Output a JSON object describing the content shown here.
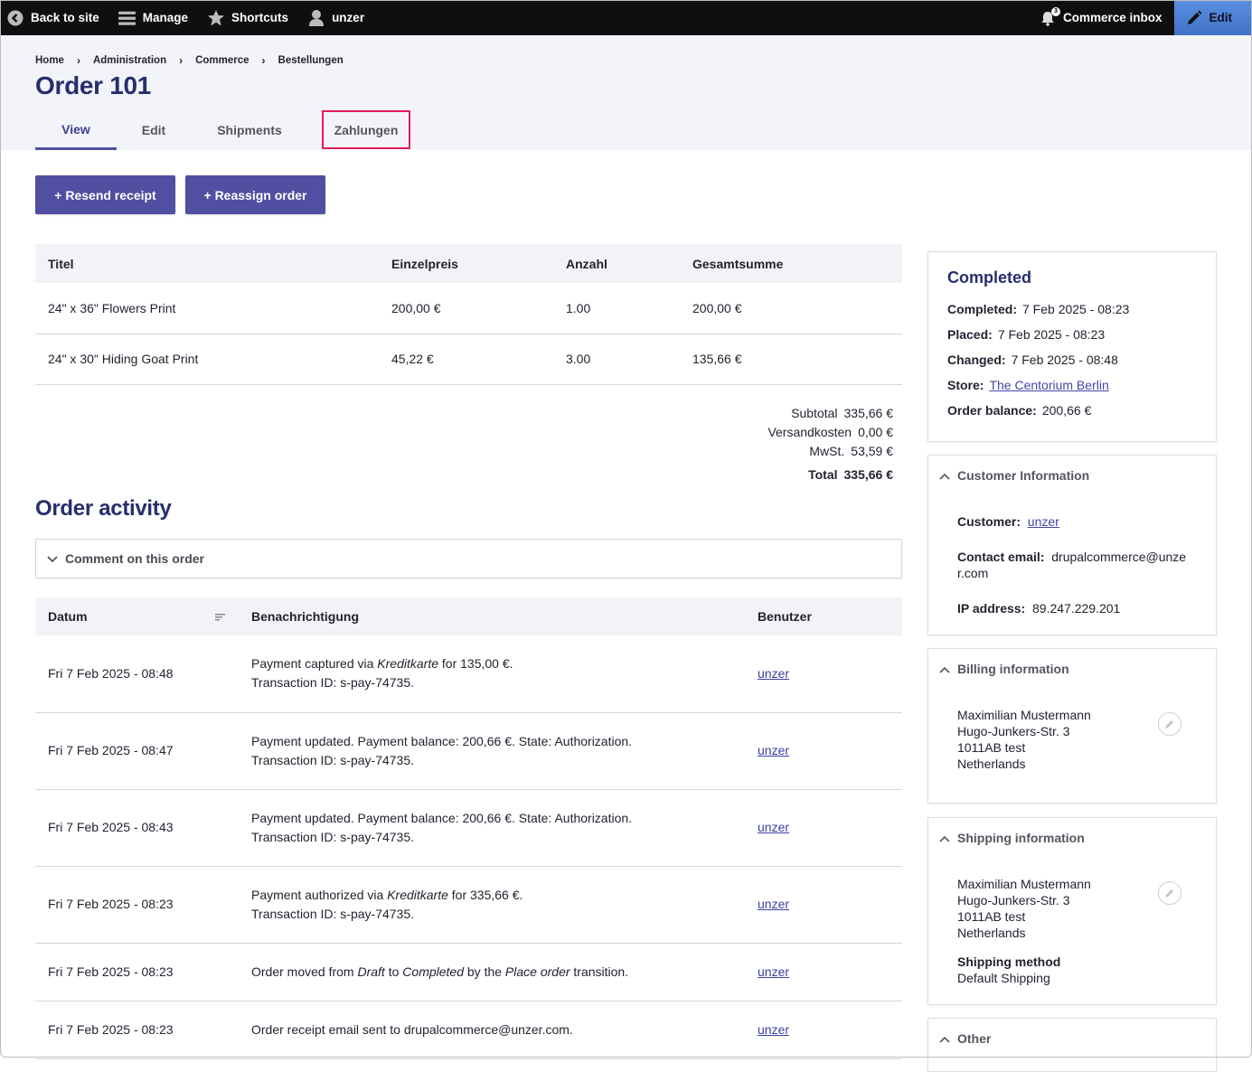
{
  "toolbar": {
    "back_to_site": "Back to site",
    "manage": "Manage",
    "shortcuts": "Shortcuts",
    "user": "unzer",
    "commerce_inbox": "Commerce inbox",
    "inbox_count": "3",
    "edit": "Edit"
  },
  "breadcrumb": [
    "Home",
    "Administration",
    "Commerce",
    "Bestellungen"
  ],
  "page_title": "Order 101",
  "tabs": [
    {
      "label": "View",
      "active": true
    },
    {
      "label": "Edit",
      "active": false
    },
    {
      "label": "Shipments",
      "active": false
    },
    {
      "label": "Zahlungen",
      "active": false,
      "highlighted": true
    }
  ],
  "actions": {
    "resend_receipt": "+ Resend receipt",
    "reassign_order": "+ Reassign order"
  },
  "order_items": {
    "headers": [
      "Titel",
      "Einzelpreis",
      "Anzahl",
      "Gesamtsumme"
    ],
    "rows": [
      [
        "24\" x 36\" Flowers Print",
        "200,00 €",
        "1.00",
        "200,00 €"
      ],
      [
        "24\" x 30\" Hiding Goat Print",
        "45,22 €",
        "3.00",
        "135,66 €"
      ]
    ]
  },
  "totals": {
    "subtotal_label": "Subtotal",
    "subtotal": "335,66 €",
    "shipping_label": "Versandkosten",
    "shipping": "0,00 €",
    "tax_label": "MwSt.",
    "tax": "53,59 €",
    "total_label": "Total",
    "total": "335,66 €"
  },
  "activity": {
    "title": "Order activity",
    "comment_label": "Comment on this order",
    "headers": [
      "Datum",
      "Benachrichtigung",
      "Benutzer"
    ],
    "rows": [
      {
        "date": "Fri 7 Feb 2025 - 08:48",
        "line1_html": "Payment captured via <em>Kreditkarte</em> for 135,00 €.",
        "line2": "Transaction ID: s-pay-74735.",
        "user": "unzer"
      },
      {
        "date": "Fri 7 Feb 2025 - 08:47",
        "line1_html": "Payment updated. Payment balance: 200,66 €. State: Authorization.",
        "line2": "Transaction ID: s-pay-74735.",
        "user": "unzer"
      },
      {
        "date": "Fri 7 Feb 2025 - 08:43",
        "line1_html": "Payment updated. Payment balance: 200,66 €. State: Authorization.",
        "line2": "Transaction ID: s-pay-74735.",
        "user": "unzer"
      },
      {
        "date": "Fri 7 Feb 2025 - 08:23",
        "line1_html": "Payment authorized via <em>Kreditkarte</em> for 335,66 €.",
        "line2": "Transaction ID: s-pay-74735.",
        "user": "unzer"
      },
      {
        "date": "Fri 7 Feb 2025 - 08:23",
        "line1_html": "Order moved from <em>Draft</em> to <em>Completed</em> by the <em>Place order</em> transition.",
        "line2": "",
        "user": "unzer"
      },
      {
        "date": "Fri 7 Feb 2025 - 08:23",
        "line1_html": "Order receipt email sent to drupalcommerce@unzer.com.",
        "line2": "",
        "user": "unzer"
      }
    ]
  },
  "status": {
    "title": "Completed",
    "completed_label": "Completed:",
    "completed": "7 Feb 2025 - 08:23",
    "placed_label": "Placed:",
    "placed": "7 Feb 2025 - 08:23",
    "changed_label": "Changed:",
    "changed": "7 Feb 2025 - 08:48",
    "store_label": "Store:",
    "store": "The Centorium Berlin",
    "balance_label": "Order balance:",
    "balance": "200,66 €"
  },
  "customer": {
    "title": "Customer Information",
    "customer_label": "Customer:",
    "customer": "unzer",
    "email_label": "Contact email:",
    "email": "drupalcommerce@unzer.com",
    "ip_label": "IP address:",
    "ip": "89.247.229.201"
  },
  "billing": {
    "title": "Billing information",
    "lines": [
      "Maximilian Mustermann",
      "Hugo-Junkers-Str. 3",
      "1011AB test",
      "Netherlands"
    ]
  },
  "shipping": {
    "title": "Shipping information",
    "lines": [
      "Maximilian Mustermann",
      "Hugo-Junkers-Str. 3",
      "1011AB test",
      "Netherlands"
    ],
    "method_label": "Shipping method",
    "method": "Default Shipping"
  },
  "other": {
    "title": "Other"
  },
  "colors": {
    "accent": "#514fa1",
    "title": "#272e6d",
    "highlight": "#e41c5c",
    "edit_tab": "#4a7fd4"
  }
}
